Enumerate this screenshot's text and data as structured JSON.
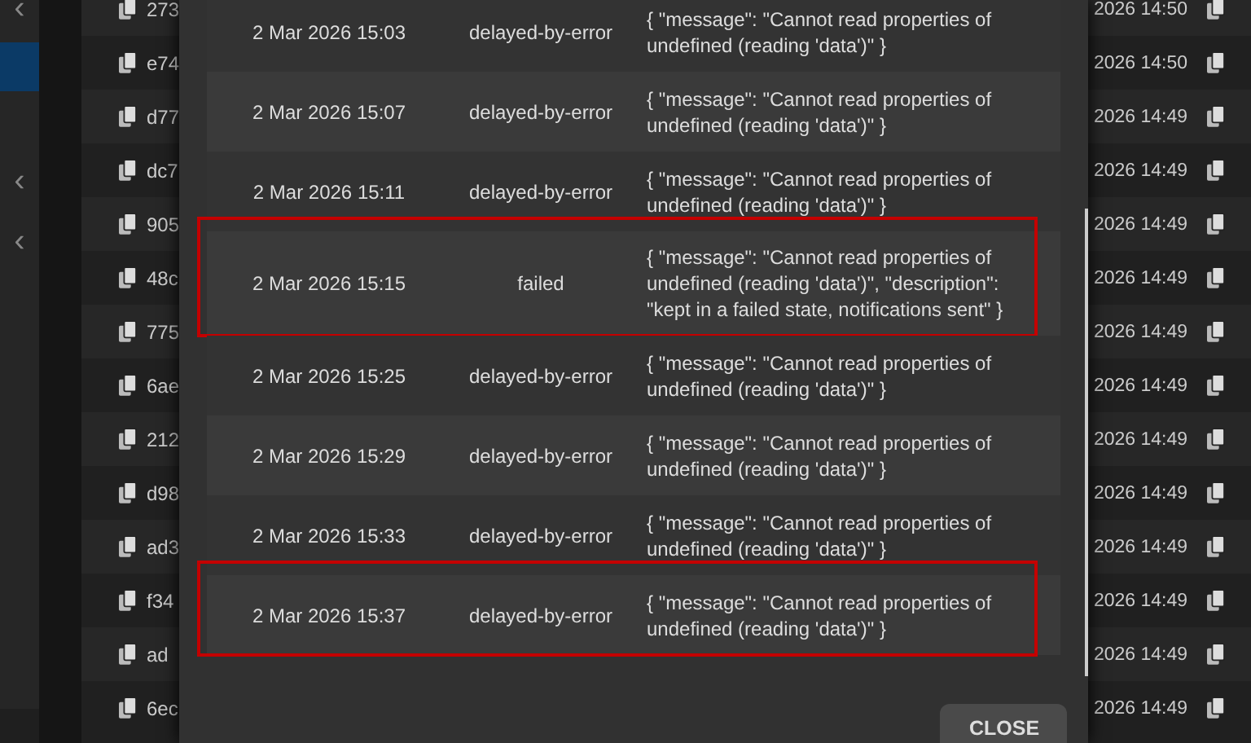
{
  "sidebar": {
    "items": [
      {
        "kind": "chevron",
        "label": "‹",
        "selected": false
      },
      {
        "kind": "item",
        "selected": true
      },
      {
        "kind": "chevron",
        "label": "‹",
        "selected": false
      },
      {
        "kind": "chevron",
        "label": "‹",
        "selected": false
      }
    ]
  },
  "background_table": {
    "rows": [
      {
        "id": "273",
        "time": "2026 14:50"
      },
      {
        "id": "e74",
        "time": "2026 14:50"
      },
      {
        "id": "d77",
        "time": "2026 14:49"
      },
      {
        "id": "dc7",
        "time": "2026 14:49"
      },
      {
        "id": "905",
        "time": "2026 14:49"
      },
      {
        "id": "48c",
        "time": "2026 14:49"
      },
      {
        "id": "775",
        "time": "2026 14:49"
      },
      {
        "id": "6ae",
        "time": "2026 14:49"
      },
      {
        "id": "212",
        "time": "2026 14:49"
      },
      {
        "id": "d98",
        "time": "2026 14:49"
      },
      {
        "id": "ad3",
        "time": "2026 14:49"
      },
      {
        "id": "f34",
        "time": "2026 14:49"
      },
      {
        "id": "ad",
        "time": "2026 14:49"
      },
      {
        "id": "6ec",
        "time": "2026 14:49"
      }
    ]
  },
  "dialog": {
    "rows": [
      {
        "date": "2 Mar 2026 15:03",
        "status": "delayed-by-error",
        "message": "{ \"message\": \"Cannot read properties of undefined (reading 'data')\" }",
        "highlighted": false
      },
      {
        "date": "2 Mar 2026 15:07",
        "status": "delayed-by-error",
        "message": "{ \"message\": \"Cannot read properties of undefined (reading 'data')\" }",
        "highlighted": false
      },
      {
        "date": "2 Mar 2026 15:11",
        "status": "delayed-by-error",
        "message": "{ \"message\": \"Cannot read properties of undefined (reading 'data')\" }",
        "highlighted": false
      },
      {
        "date": "2 Mar 2026 15:15",
        "status": "failed",
        "message": "{ \"message\": \"Cannot read properties of undefined (reading 'data')\", \"description\": \"kept in a failed state, notifications sent\" }",
        "highlighted": true
      },
      {
        "date": "2 Mar 2026 15:25",
        "status": "delayed-by-error",
        "message": "{ \"message\": \"Cannot read properties of undefined (reading 'data')\" }",
        "highlighted": false
      },
      {
        "date": "2 Mar 2026 15:29",
        "status": "delayed-by-error",
        "message": "{ \"message\": \"Cannot read properties of undefined (reading 'data')\" }",
        "highlighted": false
      },
      {
        "date": "2 Mar 2026 15:33",
        "status": "delayed-by-error",
        "message": "{ \"message\": \"Cannot read properties of undefined (reading 'data')\" }",
        "highlighted": false
      },
      {
        "date": "2 Mar 2026 15:37",
        "status": "delayed-by-error",
        "message": "{ \"message\": \"Cannot read properties of undefined (reading 'data')\" }",
        "highlighted": true
      }
    ],
    "close_button": "CLOSE"
  }
}
